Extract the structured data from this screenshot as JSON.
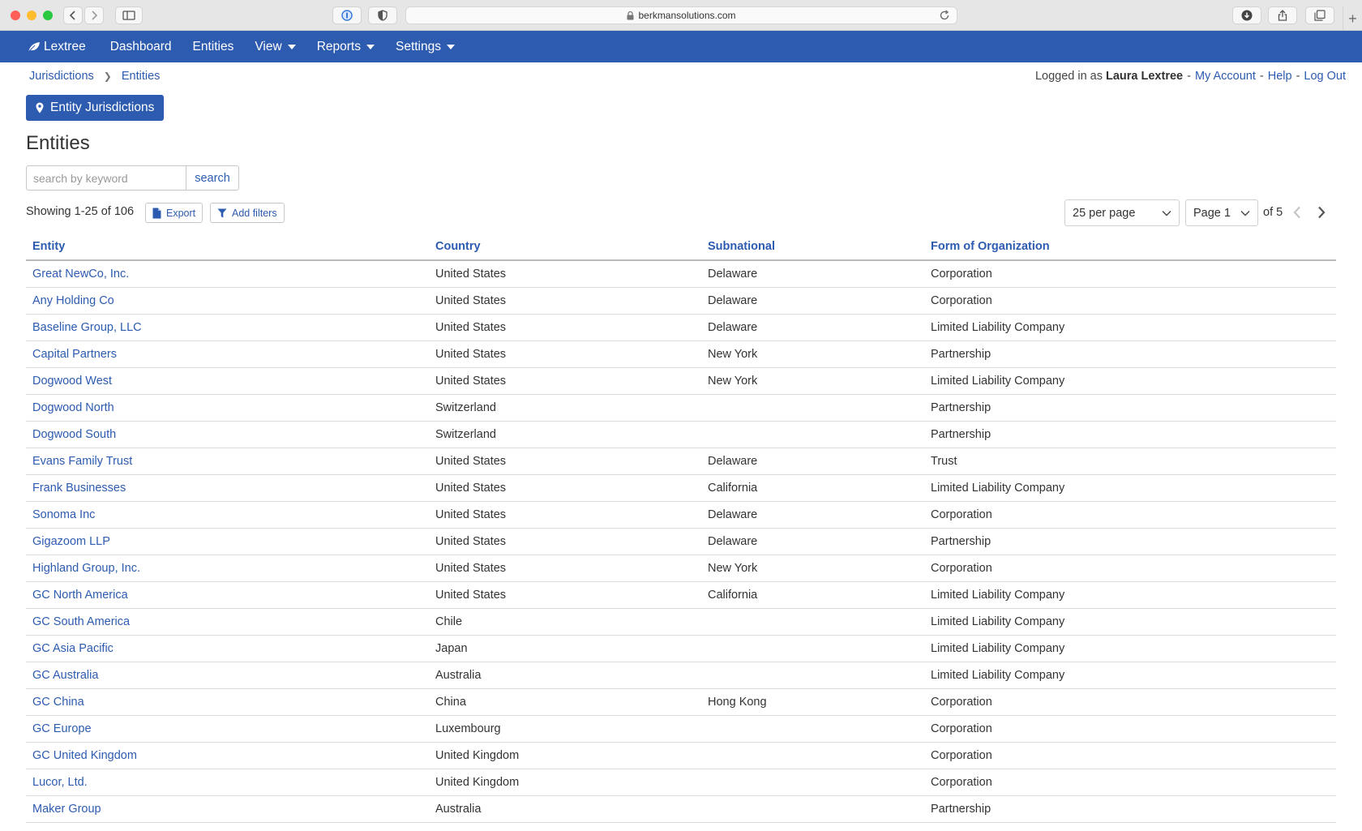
{
  "browser": {
    "url": "berkmansolutions.com"
  },
  "nav": {
    "brand": "Lextree",
    "items": [
      {
        "label": "Dashboard",
        "dropdown": false
      },
      {
        "label": "Entities",
        "dropdown": false
      },
      {
        "label": "View",
        "dropdown": true
      },
      {
        "label": "Reports",
        "dropdown": true
      },
      {
        "label": "Settings",
        "dropdown": true
      }
    ]
  },
  "breadcrumb": {
    "items": [
      "Jurisdictions",
      "Entities"
    ]
  },
  "user": {
    "prefix": "Logged in as",
    "name": "Laura Lextree",
    "links": [
      "My Account",
      "Help",
      "Log Out"
    ]
  },
  "jurisdictions_button": "Entity Jurisdictions",
  "page_title": "Entities",
  "search": {
    "placeholder": "search by keyword",
    "button": "search"
  },
  "results": {
    "showing": "Showing 1-25 of 106",
    "export_label": "Export",
    "filters_label": "Add filters"
  },
  "pagination": {
    "per_page": "25 per page",
    "page": "Page 1",
    "of_pages": "of 5"
  },
  "table": {
    "columns": [
      "Entity",
      "Country",
      "Subnational",
      "Form of Organization"
    ],
    "rows": [
      [
        "Great NewCo, Inc.",
        "United States",
        "Delaware",
        "Corporation"
      ],
      [
        "Any Holding Co",
        "United States",
        "Delaware",
        "Corporation"
      ],
      [
        "Baseline Group, LLC",
        "United States",
        "Delaware",
        "Limited Liability Company"
      ],
      [
        "Capital Partners",
        "United States",
        "New York",
        "Partnership"
      ],
      [
        "Dogwood West",
        "United States",
        "New York",
        "Limited Liability Company"
      ],
      [
        "Dogwood North",
        "Switzerland",
        "",
        "Partnership"
      ],
      [
        "Dogwood South",
        "Switzerland",
        "",
        "Partnership"
      ],
      [
        "Evans Family Trust",
        "United States",
        "Delaware",
        "Trust"
      ],
      [
        "Frank Businesses",
        "United States",
        "California",
        "Limited Liability Company"
      ],
      [
        "Sonoma Inc",
        "United States",
        "Delaware",
        "Corporation"
      ],
      [
        "Gigazoom LLP",
        "United States",
        "Delaware",
        "Partnership"
      ],
      [
        "Highland Group, Inc.",
        "United States",
        "New York",
        "Corporation"
      ],
      [
        "GC North America",
        "United States",
        "California",
        "Limited Liability Company"
      ],
      [
        "GC South America",
        "Chile",
        "",
        "Limited Liability Company"
      ],
      [
        "GC Asia Pacific",
        "Japan",
        "",
        "Limited Liability Company"
      ],
      [
        "GC Australia",
        "Australia",
        "",
        "Limited Liability Company"
      ],
      [
        "GC China",
        "China",
        "Hong Kong",
        "Corporation"
      ],
      [
        "GC Europe",
        "Luxembourg",
        "",
        "Corporation"
      ],
      [
        "GC United Kingdom",
        "United Kingdom",
        "",
        "Corporation"
      ],
      [
        "Lucor, Ltd.",
        "United Kingdom",
        "",
        "Corporation"
      ],
      [
        "Maker Group",
        "Australia",
        "",
        "Partnership"
      ]
    ]
  },
  "colors": {
    "primary": "#2d5bb0",
    "text": "#333333"
  }
}
